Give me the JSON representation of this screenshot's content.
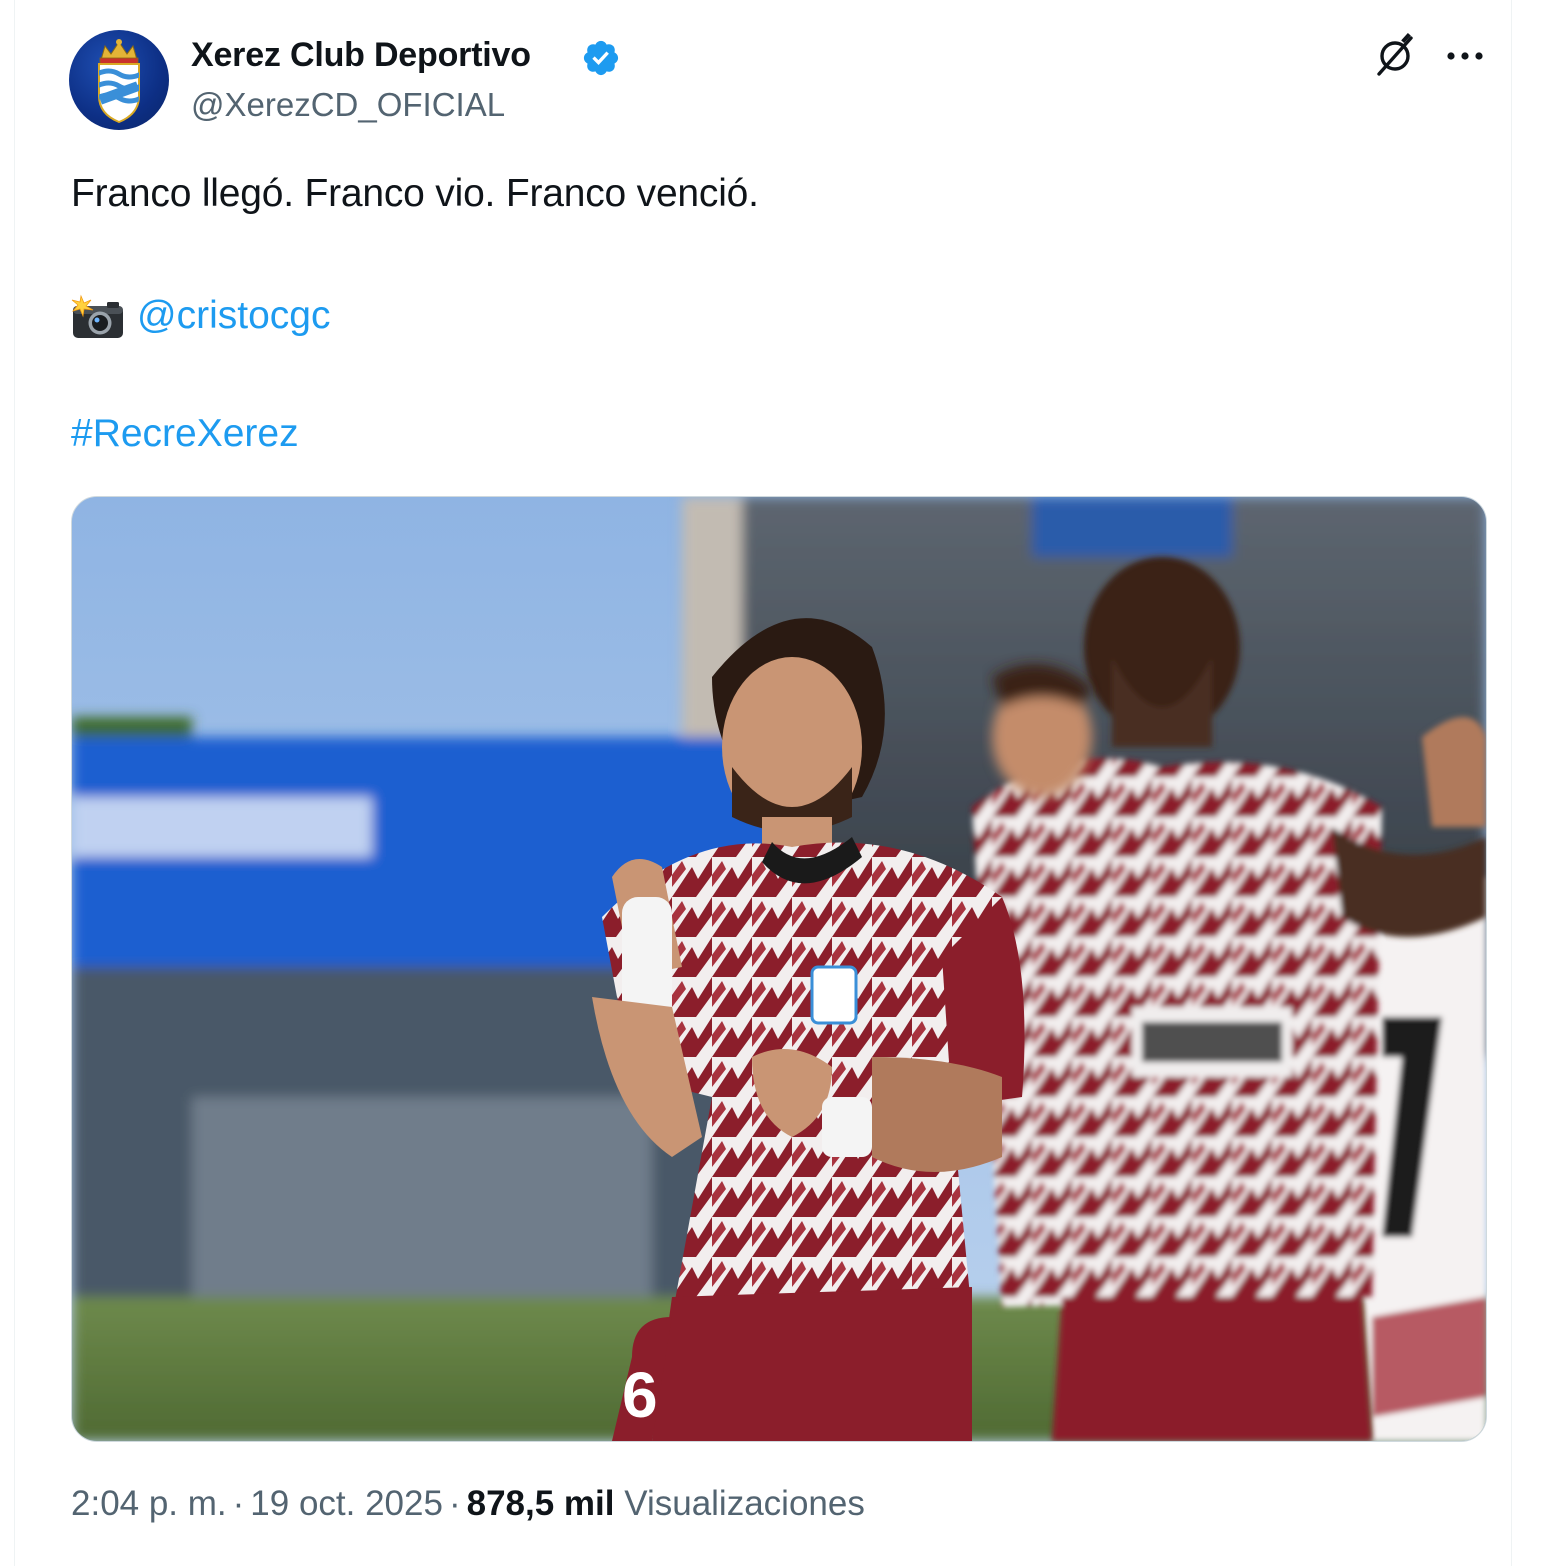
{
  "author": {
    "display_name": "Xerez Club Deportivo",
    "handle": "@XerezCD_OFICIAL",
    "verified": true,
    "badge_color": "#1d9bf0"
  },
  "tweet": {
    "text": "Franco llegó. Franco vio. Franco venció.",
    "photo_credit_icon": "camera-flash-icon",
    "mention": "@cristocgc",
    "hashtag": "#RecreXerez",
    "link_color": "#1d9bf0"
  },
  "media": {
    "type": "photo",
    "jersey_colors": [
      "#8b1e2b",
      "#ffffff"
    ]
  },
  "meta": {
    "time": "2:04 p. m.",
    "date": "19 oct. 2025",
    "separator": "·",
    "views_count": "878,5 mil",
    "views_label": "Visualizaciones"
  },
  "actions": {
    "grok_icon": "grok-slash-icon",
    "more_icon": "more-dots-icon"
  }
}
